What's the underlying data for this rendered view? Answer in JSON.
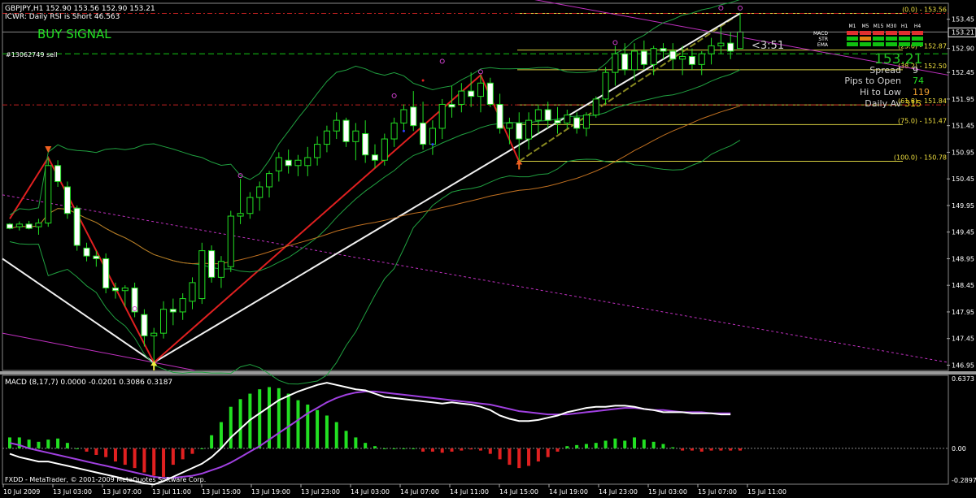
{
  "header": {
    "symbol_line": "GBPJPY,H1  152.90 153.56 152.90 153.21",
    "indicator_line": "ICWR: Daily RSI is Short 46.563",
    "signal_label": "BUY SIGNAL",
    "order_label": "#13062749 sell",
    "countdown": "<3:51",
    "current_price_big": "153.21"
  },
  "info_panel": {
    "spread_label": "Spread",
    "spread_value": "9",
    "pips_label": "Pips to Open",
    "pips_value": "74",
    "hilo_label": "Hi to Low",
    "hilo_value": "119",
    "daily_label": "Daily Av",
    "daily_value": "315"
  },
  "mtf_panel": {
    "timeframes": [
      "M1",
      "M5",
      "M15",
      "M30",
      "H1",
      "H4"
    ],
    "rows": [
      {
        "label": "MACD",
        "colors": [
          "#e03030",
          "#e03030",
          "#e03030",
          "#e03030",
          "#e03030",
          "#e03030"
        ]
      },
      {
        "label": "STR",
        "colors": [
          "#10c010",
          "#e08010",
          "#10c010",
          "#10c010",
          "#10c010",
          "#10c010"
        ]
      },
      {
        "label": "EMA",
        "colors": [
          "#10c010",
          "#10c010",
          "#10c010",
          "#10c010",
          "#10c010",
          "#10c010"
        ]
      }
    ]
  },
  "chart_data": {
    "type": "candlestick",
    "price_axis": {
      "ticks": [
        "153.45",
        "152.90",
        "152.45",
        "151.95",
        "151.45",
        "150.95",
        "150.45",
        "149.95",
        "149.45",
        "148.95",
        "148.45",
        "147.95",
        "147.45",
        "146.95"
      ],
      "current_price_tag": "153.21",
      "ylim": [
        146.85,
        153.75
      ]
    },
    "time_axis": {
      "labels": [
        "10 Jul 2009",
        "13 Jul 03:00",
        "13 Jul 07:00",
        "13 Jul 11:00",
        "13 Jul 15:00",
        "13 Jul 19:00",
        "13 Jul 23:00",
        "14 Jul 03:00",
        "14 Jul 07:00",
        "14 Jul 11:00",
        "14 Jul 15:00",
        "14 Jul 19:00",
        "14 Jul 23:00",
        "15 Jul 03:00",
        "15 Jul 07:00",
        "15 Jul 11:00"
      ]
    },
    "fib_levels": [
      {
        "label": "(0.0) - 153.56",
        "price": 153.56
      },
      {
        "label": "(25.0) - 152.87",
        "price": 152.87
      },
      {
        "label": "(38.2) - 152.50",
        "price": 152.5
      },
      {
        "label": "(61.8) - 151.84",
        "price": 151.84
      },
      {
        "label": "(75.0) - 151.47",
        "price": 151.47
      },
      {
        "label": "(100.0) - 150.78",
        "price": 150.78
      }
    ],
    "candles": [
      [
        149.6,
        149.62,
        149.5,
        149.52
      ],
      [
        149.55,
        149.65,
        149.48,
        149.6
      ],
      [
        149.6,
        149.66,
        149.5,
        149.52
      ],
      [
        149.55,
        149.7,
        149.4,
        149.62
      ],
      [
        149.62,
        150.85,
        149.55,
        150.7
      ],
      [
        150.7,
        150.8,
        150.3,
        150.4
      ],
      [
        150.3,
        150.4,
        149.7,
        149.8
      ],
      [
        149.9,
        149.95,
        149.1,
        149.2
      ],
      [
        149.15,
        149.25,
        148.9,
        149.0
      ],
      [
        149.0,
        149.1,
        148.8,
        148.95
      ],
      [
        148.95,
        149.05,
        148.3,
        148.4
      ],
      [
        148.4,
        148.5,
        148.2,
        148.35
      ],
      [
        148.35,
        148.45,
        148.05,
        148.4
      ],
      [
        148.4,
        148.5,
        147.85,
        147.95
      ],
      [
        147.9,
        148.0,
        147.3,
        147.5
      ],
      [
        147.5,
        147.65,
        147.0,
        147.55
      ],
      [
        147.55,
        148.15,
        147.45,
        148.0
      ],
      [
        148.0,
        148.2,
        147.7,
        147.95
      ],
      [
        147.95,
        148.3,
        147.8,
        148.2
      ],
      [
        148.15,
        148.6,
        148.0,
        148.5
      ],
      [
        148.2,
        149.25,
        148.1,
        149.1
      ],
      [
        149.1,
        149.2,
        148.5,
        148.6
      ],
      [
        148.6,
        149.0,
        148.4,
        148.9
      ],
      [
        148.8,
        149.85,
        148.7,
        149.75
      ],
      [
        149.75,
        150.45,
        149.6,
        149.8
      ],
      [
        149.8,
        150.2,
        149.7,
        150.1
      ],
      [
        150.1,
        150.4,
        149.85,
        150.3
      ],
      [
        150.3,
        150.6,
        150.1,
        150.55
      ],
      [
        150.6,
        150.95,
        150.4,
        150.85
      ],
      [
        150.8,
        151.0,
        150.55,
        150.7
      ],
      [
        150.7,
        150.9,
        150.5,
        150.8
      ],
      [
        150.7,
        151.05,
        150.5,
        150.85
      ],
      [
        150.85,
        151.25,
        150.7,
        151.1
      ],
      [
        151.1,
        151.45,
        150.95,
        151.35
      ],
      [
        151.35,
        151.7,
        151.2,
        151.55
      ],
      [
        151.55,
        151.6,
        151.05,
        151.15
      ],
      [
        151.15,
        151.5,
        150.8,
        151.35
      ],
      [
        151.3,
        151.55,
        150.75,
        150.9
      ],
      [
        150.9,
        151.1,
        150.65,
        150.8
      ],
      [
        150.8,
        151.3,
        150.7,
        151.2
      ],
      [
        151.2,
        151.6,
        151.05,
        151.5
      ],
      [
        151.5,
        151.85,
        151.35,
        151.75
      ],
      [
        151.8,
        152.1,
        151.35,
        151.45
      ],
      [
        151.5,
        151.9,
        151.0,
        151.1
      ],
      [
        151.1,
        151.55,
        150.9,
        151.4
      ],
      [
        151.4,
        151.95,
        151.2,
        151.85
      ],
      [
        151.85,
        152.2,
        151.6,
        151.8
      ],
      [
        151.85,
        152.25,
        151.7,
        152.1
      ],
      [
        152.1,
        152.45,
        151.8,
        152.0
      ],
      [
        152.0,
        152.4,
        151.7,
        152.25
      ],
      [
        152.25,
        152.35,
        151.8,
        151.85
      ],
      [
        151.85,
        152.05,
        151.3,
        151.4
      ],
      [
        151.4,
        151.6,
        151.1,
        151.5
      ],
      [
        151.5,
        151.7,
        150.8,
        151.2
      ],
      [
        151.2,
        151.7,
        151.0,
        151.55
      ],
      [
        151.55,
        151.85,
        151.3,
        151.75
      ],
      [
        151.75,
        151.9,
        151.4,
        151.55
      ],
      [
        151.55,
        151.8,
        151.3,
        151.5
      ],
      [
        151.5,
        151.75,
        151.4,
        151.65
      ],
      [
        151.6,
        151.7,
        151.3,
        151.4
      ],
      [
        151.4,
        151.7,
        151.25,
        151.65
      ],
      [
        151.65,
        152.0,
        151.6,
        151.95
      ],
      [
        151.95,
        152.55,
        151.85,
        152.45
      ],
      [
        152.45,
        152.95,
        152.2,
        152.8
      ],
      [
        152.8,
        153.0,
        152.4,
        152.5
      ],
      [
        152.5,
        153.0,
        152.3,
        152.85
      ],
      [
        152.85,
        153.05,
        152.5,
        152.6
      ],
      [
        152.6,
        152.95,
        152.4,
        152.9
      ],
      [
        152.9,
        153.0,
        152.7,
        152.85
      ],
      [
        152.85,
        153.0,
        152.5,
        152.7
      ],
      [
        152.7,
        152.95,
        152.4,
        152.75
      ],
      [
        152.75,
        152.9,
        152.5,
        152.6
      ],
      [
        152.6,
        152.85,
        152.4,
        152.8
      ],
      [
        152.8,
        153.1,
        152.6,
        152.95
      ],
      [
        152.95,
        153.3,
        152.8,
        153.0
      ],
      [
        153.0,
        153.2,
        152.7,
        152.85
      ],
      [
        152.9,
        153.56,
        152.9,
        153.21
      ]
    ],
    "macd": {
      "label": "MACD (8,17,7) 0.0000 -0.0201 0.3086 0.3187",
      "ticks": [
        "0.6373",
        "0.00",
        "-0.2897"
      ],
      "ylim": [
        -0.32,
        0.66
      ],
      "hist": [
        0.1,
        0.1,
        0.08,
        0.06,
        0.08,
        0.09,
        0.05,
        0.0,
        -0.03,
        -0.06,
        -0.08,
        -0.12,
        -0.15,
        -0.18,
        -0.22,
        -0.25,
        -0.26,
        -0.15,
        -0.1,
        -0.05,
        0.0,
        0.12,
        0.24,
        0.38,
        0.45,
        0.5,
        0.54,
        0.56,
        0.55,
        0.5,
        0.44,
        0.4,
        0.35,
        0.3,
        0.24,
        0.16,
        0.1,
        0.05,
        0.02,
        0.0,
        0.0,
        0.0,
        0.0,
        -0.03,
        -0.03,
        -0.04,
        -0.03,
        -0.02,
        -0.01,
        -0.02,
        -0.05,
        -0.1,
        -0.15,
        -0.18,
        -0.16,
        -0.12,
        -0.08,
        -0.03,
        0.02,
        0.03,
        0.04,
        0.05,
        0.07,
        0.09,
        0.07,
        0.1,
        0.08,
        0.06,
        0.04,
        0.01,
        -0.02,
        -0.02,
        -0.03,
        -0.02,
        -0.02,
        -0.02,
        -0.02
      ],
      "main": [
        -0.05,
        -0.08,
        -0.1,
        -0.12,
        -0.12,
        -0.14,
        -0.16,
        -0.18,
        -0.2,
        -0.22,
        -0.24,
        -0.26,
        -0.28,
        -0.3,
        -0.32,
        -0.33,
        -0.3,
        -0.26,
        -0.22,
        -0.18,
        -0.14,
        -0.08,
        0.0,
        0.1,
        0.18,
        0.26,
        0.32,
        0.38,
        0.44,
        0.48,
        0.52,
        0.55,
        0.58,
        0.6,
        0.58,
        0.56,
        0.54,
        0.53,
        0.5,
        0.47,
        0.46,
        0.45,
        0.44,
        0.43,
        0.42,
        0.41,
        0.42,
        0.41,
        0.4,
        0.38,
        0.35,
        0.3,
        0.27,
        0.25,
        0.25,
        0.26,
        0.28,
        0.3,
        0.33,
        0.35,
        0.37,
        0.38,
        0.38,
        0.39,
        0.39,
        0.38,
        0.36,
        0.35,
        0.33,
        0.33,
        0.33,
        0.32,
        0.32,
        0.32,
        0.31,
        0.31
      ],
      "signal": [
        0.05,
        0.03,
        0.0,
        -0.02,
        -0.04,
        -0.06,
        -0.08,
        -0.1,
        -0.12,
        -0.14,
        -0.16,
        -0.18,
        -0.2,
        -0.22,
        -0.24,
        -0.26,
        -0.27,
        -0.27,
        -0.26,
        -0.25,
        -0.23,
        -0.2,
        -0.17,
        -0.13,
        -0.08,
        -0.03,
        0.02,
        0.08,
        0.14,
        0.2,
        0.26,
        0.32,
        0.37,
        0.42,
        0.46,
        0.49,
        0.51,
        0.52,
        0.52,
        0.51,
        0.5,
        0.49,
        0.48,
        0.47,
        0.46,
        0.45,
        0.44,
        0.43,
        0.42,
        0.41,
        0.4,
        0.38,
        0.36,
        0.34,
        0.33,
        0.32,
        0.31,
        0.31,
        0.31,
        0.32,
        0.33,
        0.34,
        0.35,
        0.36,
        0.37,
        0.37,
        0.36,
        0.35,
        0.35,
        0.34,
        0.33,
        0.33,
        0.33,
        0.32,
        0.32,
        0.32
      ]
    }
  },
  "footer": {
    "copyright": "FXDD - MetaTrader, © 2001-2009 MetaQuotes Software Corp."
  }
}
